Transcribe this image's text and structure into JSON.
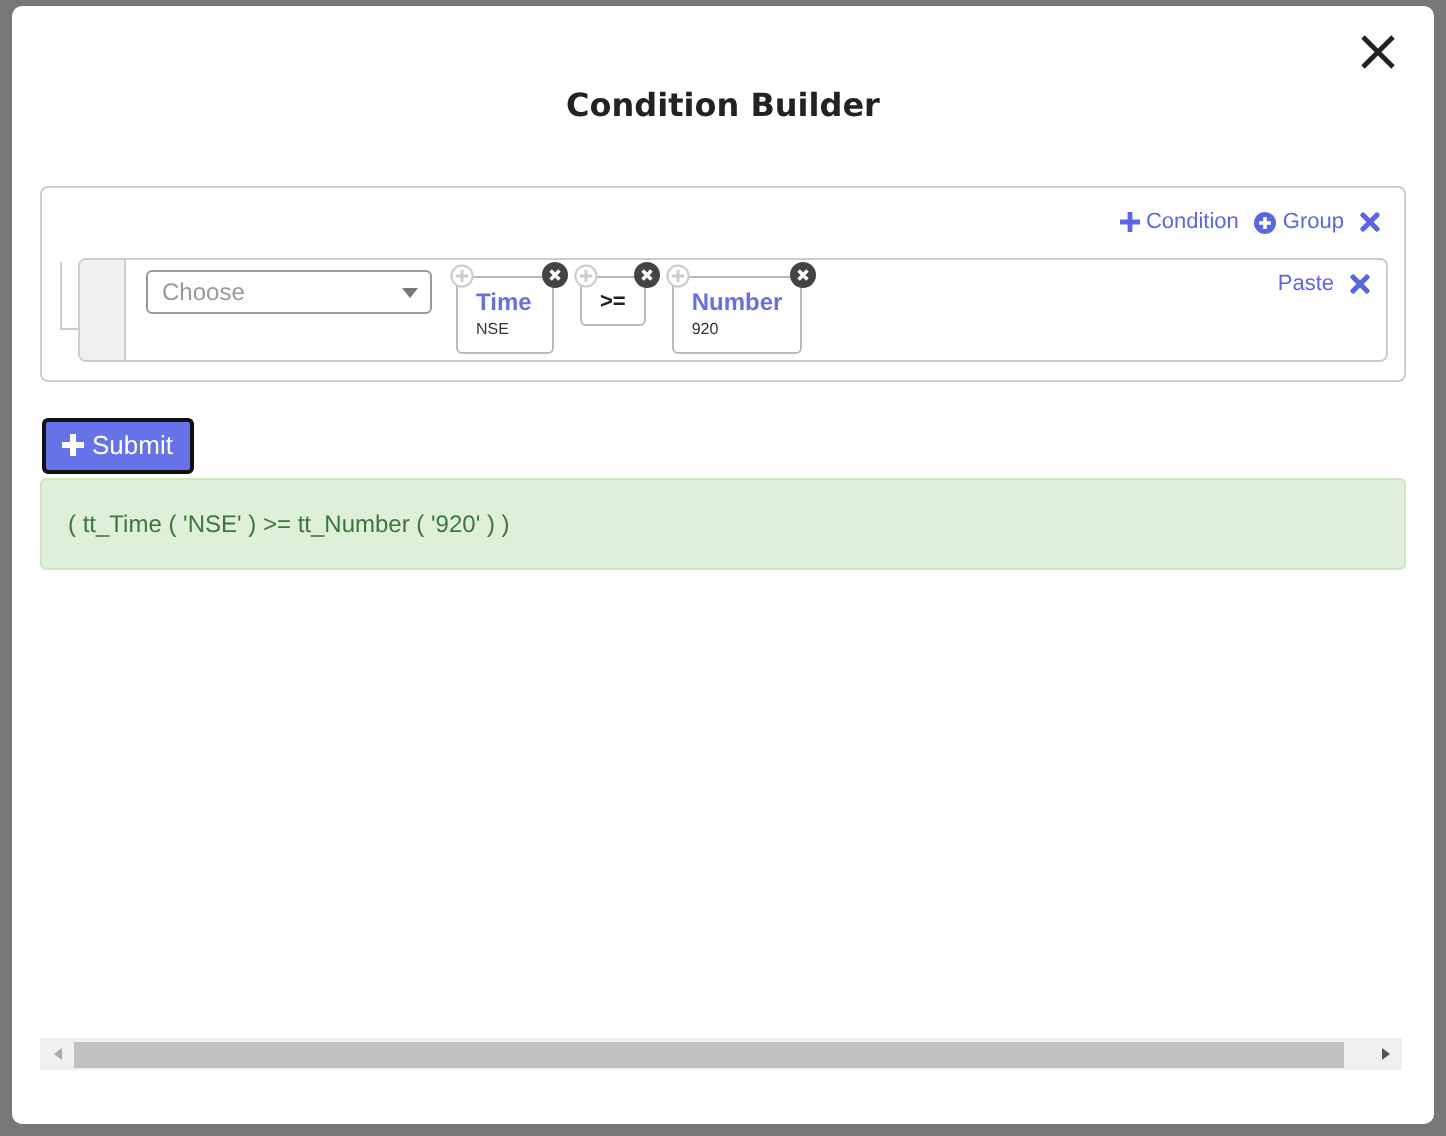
{
  "dialog": {
    "title": "Condition Builder"
  },
  "builder": {
    "actions": [
      {
        "kind": "condition",
        "label": "Condition"
      },
      {
        "kind": "group",
        "label": "Group"
      }
    ],
    "rule": {
      "select": {
        "placeholder": "Choose"
      },
      "tokens": [
        {
          "kind": "field",
          "label": "Time",
          "detail": "NSE"
        },
        {
          "kind": "operator",
          "label": ">="
        },
        {
          "kind": "field",
          "label": "Number",
          "detail": "920"
        }
      ],
      "paste": "Paste"
    }
  },
  "submit": {
    "label": "Submit"
  },
  "result": "( tt_Time ( 'NSE' ) >= tt_Number ( '920' ) )"
}
